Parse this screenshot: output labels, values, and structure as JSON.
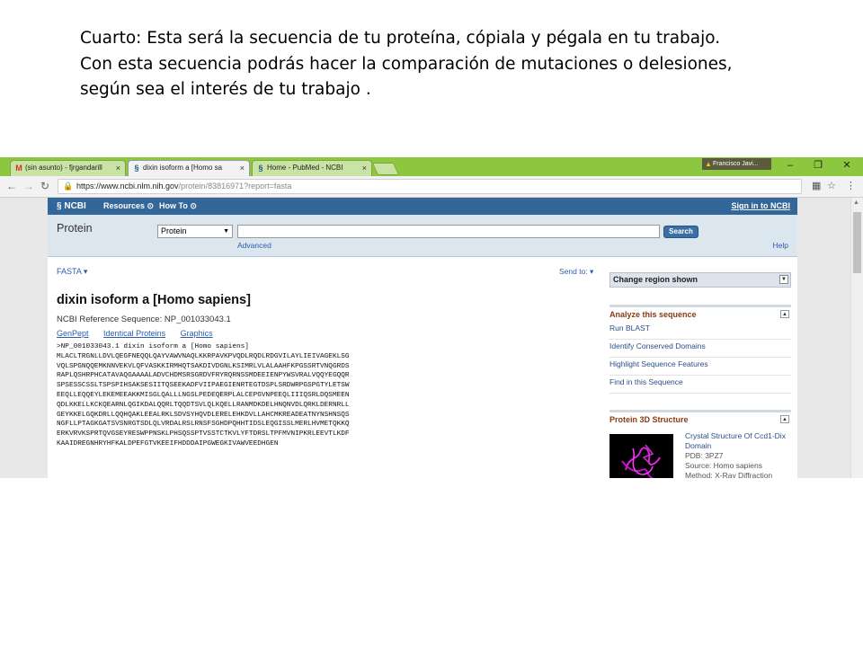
{
  "caption": {
    "line1": "Cuarto: Esta será la secuencia de tu proteína, cópiala y pégala en tu trabajo.",
    "line2": "Con esta secuencia podrás hacer la comparación de mutaciones o delesiones,",
    "line3": "según sea el interés de tu trabajo ."
  },
  "browser": {
    "tabs": [
      {
        "icon": "M",
        "label": "(sin asunto) - fjrgandarill"
      },
      {
        "icon": "§",
        "label": "dixin isoform a [Homo sa"
      },
      {
        "icon": "§",
        "label": "Home - PubMed - NCBI"
      }
    ],
    "tab_close": "×",
    "profile_name": "Francisco Javi...",
    "url_host": "https://www.ncbi.nlm.nih.gov",
    "url_path": "/protein/83816971?report=fasta",
    "colors": {
      "tabbar": "#8dc63f",
      "ncbi_header": "#336699"
    }
  },
  "ncbi": {
    "logo": "NCBI",
    "menu_resources": "Resources",
    "menu_howto": "How To",
    "signin": "Sign in to NCBI",
    "db_label": "Protein",
    "db_select": "Protein",
    "search_button": "Search",
    "advanced": "Advanced",
    "help": "Help"
  },
  "record": {
    "format": "FASTA",
    "send_to": "Send to:",
    "title": "dixin isoform a [Homo sapiens]",
    "refseq": "NCBI Reference Sequence: NP_001033043.1",
    "links": [
      "GenPept",
      "Identical Proteins",
      "Graphics"
    ],
    "sequence": ">NP_001033043.1 dixin isoform a [Homo sapiens]\nMLACLTRGNLLDVLQEGFNEQQLQAYVAWVNAQLKKRPAVKPVQDLRQDLRDGVILAYLIEIVAGEKLSG\nVQLSPGNQQEMKNNVEKVLQFVASKKIRMHQTSAKDIVDGNLKSIMRLVLALAAHFKPGSSRTVNQGRDS\nRAPLQSHRPHCATAVAQGAAAALADVCHDMSRSGRDVFRYRQRNSSMDEEIENPYWSVRALVQQYEGQQR\nSPSESSCSSLTSPSPIHSAKSESIITQSEEKADFVIIPAEGIENRTEGTDSPLSRDWRPGSPGTYLETSW\nEEQLLEQQEYLEKEMEEAKKMISGLQALLLNGSLPEDEQERPLALCEPGVNPEEQLIIIQSRLDQSMEEN\nQDLKKELLKCKQEARNLQGIKDALQQRLTQQDTSVLQLKQELLRANMDKDELHNQNVDLQRKLDERNRLL\nGEYKKELGQKDRLLQQHQAKLEEALRKLSDVSYHQVDLERELEHKDVLLAHCMKREADEATNYNSHNSQS\nNGFLLPTAGKGATSVSNRGTSDLQLVRDALRSLRNSFSGHDPQHHTIDSLEQGISSLMERLHVMETQKKQ\nERKVRVKSPRTQVGSEYRESWPPNSKLPHSQSSPTVSSTCTKVLYFTDRSLTPFMVNIPKRLEEVTLKDF\nKAAIDREGNHRYHFKALDPEFGTVKEEIFHDDDAIPGWEGKIVAWVEEDHGEN"
  },
  "sidebar": {
    "region": "Change region shown",
    "analyze_title": "Analyze this sequence",
    "analyze_items": [
      "Run BLAST",
      "Identify Conserved Domains",
      "Highlight Sequence Features",
      "Find in this Sequence"
    ],
    "structure_title": "Protein 3D Structure",
    "structure_name": "Crystal Structure Of Ccd1-Dix Domain",
    "structure_pdb": "PDB: 3PZ7",
    "structure_source": "Source: Homo sapiens",
    "structure_method": "Method: X-Ray Diffraction"
  }
}
